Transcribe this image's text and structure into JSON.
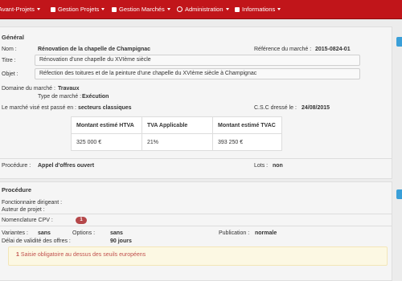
{
  "nav": {
    "items": [
      {
        "label": "Avant-Projets"
      },
      {
        "label": "Gestion Projets"
      },
      {
        "label": "Gestion Marchés"
      },
      {
        "label": "Administration"
      },
      {
        "label": "Informations"
      }
    ]
  },
  "general": {
    "title": "Général",
    "nom_label": "Nom :",
    "nom_value": "Rénovation de la chapelle de Champignac",
    "ref_label": "Référence du marché :",
    "ref_value": "2015-0824-01",
    "titre_label": "Titre :",
    "titre_value": "Rénovation d'une chapelle du XVIème siècle",
    "objet_label": "Objet :",
    "objet_value": "Réfection des toitures et de la peinture d'une chapelle du XVIème siècle à Champignac",
    "domaine_label": "Domaine du marché :",
    "domaine_value": "Travaux",
    "type_label": "Type de marché :",
    "type_value": "Exécution",
    "passe_label": "Le marché visé est passé en :",
    "passe_value": "secteurs classiques",
    "csc_label": "C.S.C dressé le :",
    "csc_value": "24/08/2015",
    "table": {
      "headers": [
        "Montant estimé HTVA",
        "TVA Applicable",
        "Montant estimé TVAC"
      ],
      "row": [
        "325 000 €",
        "21%",
        "393 250 €"
      ]
    },
    "procedure_label": "Procédure :",
    "procedure_value": "Appel d'offres ouvert",
    "lots_label": "Lots :",
    "lots_value": "non"
  },
  "procedure": {
    "title": "Procédure",
    "fonctionnaire_label": "Fonctionnaire dirigeant :",
    "auteur_label": "Auteur de projet :",
    "cpv_label": "Nomenclature CPV :",
    "cpv_count": "1",
    "variantes_label": "Variantes :",
    "variantes_value": "sans",
    "options_label": "Options :",
    "options_value": "sans",
    "publication_label": "Publication :",
    "publication_value": "normale",
    "delai_label": "Délai de validité des offres :",
    "delai_value": "90 jours",
    "alert_num": "1",
    "alert_text": "Saisie obligatoire au dessus des seuils européens"
  }
}
